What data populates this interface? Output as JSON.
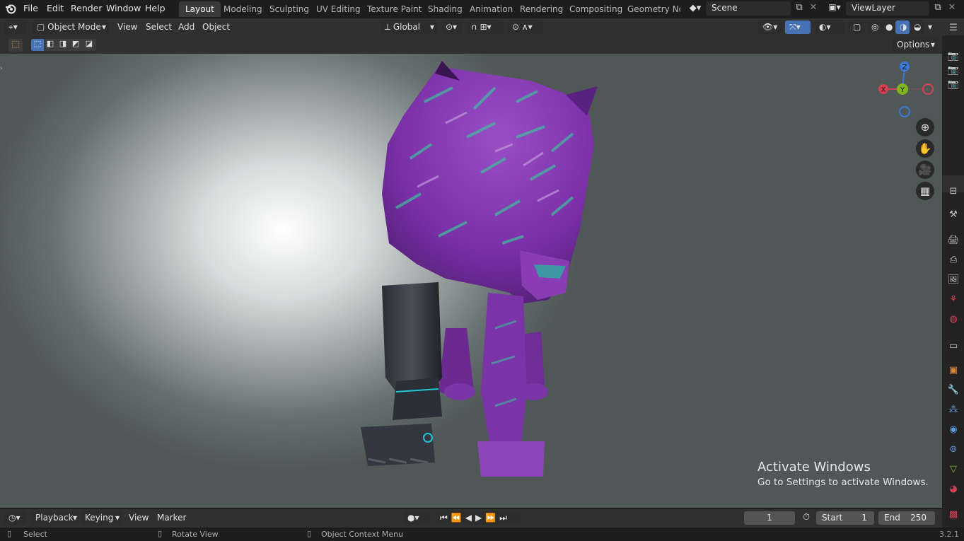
{
  "menu": [
    "File",
    "Edit",
    "Render",
    "Window",
    "Help"
  ],
  "workspaces": [
    "Layout",
    "Modeling",
    "Sculpting",
    "UV Editing",
    "Texture Paint",
    "Shading",
    "Animation",
    "Rendering",
    "Compositing",
    "Geometry Noc"
  ],
  "scene": {
    "label": "Scene",
    "viewlayer": "ViewLayer"
  },
  "header": {
    "mode": "Object Mode",
    "view": "View",
    "select": "Select",
    "add": "Add",
    "object": "Object",
    "orientation": "Global"
  },
  "toolbar": {
    "options": "Options"
  },
  "gizmo": {
    "x": "X",
    "y": "Y",
    "z": "Z"
  },
  "timeline": {
    "playback": "Playback",
    "keying": "Keying",
    "view": "View",
    "marker": "Marker",
    "current_frame": "1",
    "start_label": "Start",
    "start": "1",
    "end_label": "End",
    "end": "250"
  },
  "status": {
    "select": "Select",
    "rotate": "Rotate View",
    "context": "Object Context Menu",
    "version": "3.2.1"
  },
  "watermark": {
    "line1": "Activate Windows",
    "line2": "Go to Settings to activate Windows."
  },
  "colors": {
    "accent": "#4772b3",
    "axis_x": "#d64050",
    "axis_y": "#80b51e",
    "axis_z": "#3a7ad6"
  }
}
